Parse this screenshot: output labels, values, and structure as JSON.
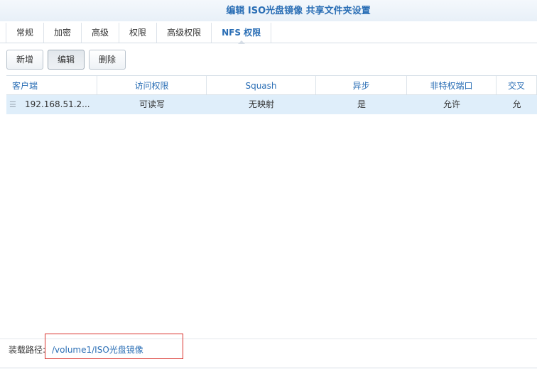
{
  "window": {
    "title": "编辑 ISO光盘镜像 共享文件夹设置"
  },
  "tabs": [
    {
      "label": "常规",
      "active": false
    },
    {
      "label": "加密",
      "active": false
    },
    {
      "label": "高级",
      "active": false
    },
    {
      "label": "权限",
      "active": false
    },
    {
      "label": "高级权限",
      "active": false
    },
    {
      "label": "NFS 权限",
      "active": true
    }
  ],
  "toolbar": {
    "add_label": "新增",
    "edit_label": "编辑",
    "delete_label": "删除"
  },
  "table": {
    "columns": [
      "客户端",
      "访问权限",
      "Squash",
      "异步",
      "非特权端口",
      "交叉"
    ],
    "rows": [
      {
        "client": "192.168.51.2...",
        "access": "可读写",
        "squash": "无映射",
        "async": "是",
        "nonpriv_port": "允许",
        "cross": "允"
      }
    ]
  },
  "footer": {
    "mount_path_label": "装载路径:",
    "mount_path_value": "/volume1/ISO光盘镜像"
  },
  "colors": {
    "accent": "#2a6eb5",
    "selected_row": "#dfeefa",
    "highlight_box": "#d9322c"
  }
}
